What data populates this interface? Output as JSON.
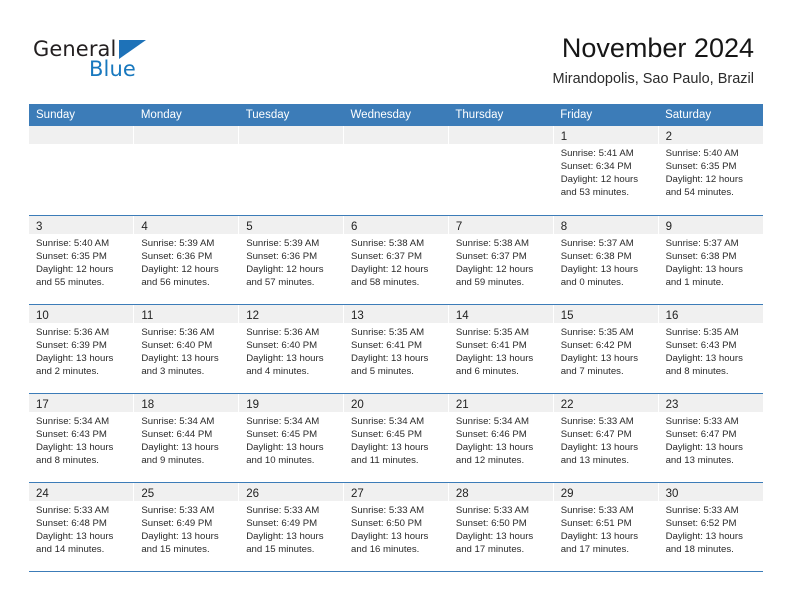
{
  "brand": {
    "name_part1": "General",
    "name_part2": "Blue",
    "accent_color": "#1e72b8"
  },
  "header": {
    "title": "November 2024",
    "subtitle": "Mirandopolis, Sao Paulo, Brazil"
  },
  "colors": {
    "header_row_bg": "#3c7cb8",
    "daynum_band_bg": "#f0f0f0",
    "row_divider": "#3c7cb8"
  },
  "weekday_headers": [
    "Sunday",
    "Monday",
    "Tuesday",
    "Wednesday",
    "Thursday",
    "Friday",
    "Saturday"
  ],
  "weeks": [
    [
      {
        "day": "",
        "sunrise": "",
        "sunset": "",
        "daylight_1": "",
        "daylight_2": ""
      },
      {
        "day": "",
        "sunrise": "",
        "sunset": "",
        "daylight_1": "",
        "daylight_2": ""
      },
      {
        "day": "",
        "sunrise": "",
        "sunset": "",
        "daylight_1": "",
        "daylight_2": ""
      },
      {
        "day": "",
        "sunrise": "",
        "sunset": "",
        "daylight_1": "",
        "daylight_2": ""
      },
      {
        "day": "",
        "sunrise": "",
        "sunset": "",
        "daylight_1": "",
        "daylight_2": ""
      },
      {
        "day": "1",
        "sunrise": "Sunrise: 5:41 AM",
        "sunset": "Sunset: 6:34 PM",
        "daylight_1": "Daylight: 12 hours",
        "daylight_2": "and 53 minutes."
      },
      {
        "day": "2",
        "sunrise": "Sunrise: 5:40 AM",
        "sunset": "Sunset: 6:35 PM",
        "daylight_1": "Daylight: 12 hours",
        "daylight_2": "and 54 minutes."
      }
    ],
    [
      {
        "day": "3",
        "sunrise": "Sunrise: 5:40 AM",
        "sunset": "Sunset: 6:35 PM",
        "daylight_1": "Daylight: 12 hours",
        "daylight_2": "and 55 minutes."
      },
      {
        "day": "4",
        "sunrise": "Sunrise: 5:39 AM",
        "sunset": "Sunset: 6:36 PM",
        "daylight_1": "Daylight: 12 hours",
        "daylight_2": "and 56 minutes."
      },
      {
        "day": "5",
        "sunrise": "Sunrise: 5:39 AM",
        "sunset": "Sunset: 6:36 PM",
        "daylight_1": "Daylight: 12 hours",
        "daylight_2": "and 57 minutes."
      },
      {
        "day": "6",
        "sunrise": "Sunrise: 5:38 AM",
        "sunset": "Sunset: 6:37 PM",
        "daylight_1": "Daylight: 12 hours",
        "daylight_2": "and 58 minutes."
      },
      {
        "day": "7",
        "sunrise": "Sunrise: 5:38 AM",
        "sunset": "Sunset: 6:37 PM",
        "daylight_1": "Daylight: 12 hours",
        "daylight_2": "and 59 minutes."
      },
      {
        "day": "8",
        "sunrise": "Sunrise: 5:37 AM",
        "sunset": "Sunset: 6:38 PM",
        "daylight_1": "Daylight: 13 hours",
        "daylight_2": "and 0 minutes."
      },
      {
        "day": "9",
        "sunrise": "Sunrise: 5:37 AM",
        "sunset": "Sunset: 6:38 PM",
        "daylight_1": "Daylight: 13 hours",
        "daylight_2": "and 1 minute."
      }
    ],
    [
      {
        "day": "10",
        "sunrise": "Sunrise: 5:36 AM",
        "sunset": "Sunset: 6:39 PM",
        "daylight_1": "Daylight: 13 hours",
        "daylight_2": "and 2 minutes."
      },
      {
        "day": "11",
        "sunrise": "Sunrise: 5:36 AM",
        "sunset": "Sunset: 6:40 PM",
        "daylight_1": "Daylight: 13 hours",
        "daylight_2": "and 3 minutes."
      },
      {
        "day": "12",
        "sunrise": "Sunrise: 5:36 AM",
        "sunset": "Sunset: 6:40 PM",
        "daylight_1": "Daylight: 13 hours",
        "daylight_2": "and 4 minutes."
      },
      {
        "day": "13",
        "sunrise": "Sunrise: 5:35 AM",
        "sunset": "Sunset: 6:41 PM",
        "daylight_1": "Daylight: 13 hours",
        "daylight_2": "and 5 minutes."
      },
      {
        "day": "14",
        "sunrise": "Sunrise: 5:35 AM",
        "sunset": "Sunset: 6:41 PM",
        "daylight_1": "Daylight: 13 hours",
        "daylight_2": "and 6 minutes."
      },
      {
        "day": "15",
        "sunrise": "Sunrise: 5:35 AM",
        "sunset": "Sunset: 6:42 PM",
        "daylight_1": "Daylight: 13 hours",
        "daylight_2": "and 7 minutes."
      },
      {
        "day": "16",
        "sunrise": "Sunrise: 5:35 AM",
        "sunset": "Sunset: 6:43 PM",
        "daylight_1": "Daylight: 13 hours",
        "daylight_2": "and 8 minutes."
      }
    ],
    [
      {
        "day": "17",
        "sunrise": "Sunrise: 5:34 AM",
        "sunset": "Sunset: 6:43 PM",
        "daylight_1": "Daylight: 13 hours",
        "daylight_2": "and 8 minutes."
      },
      {
        "day": "18",
        "sunrise": "Sunrise: 5:34 AM",
        "sunset": "Sunset: 6:44 PM",
        "daylight_1": "Daylight: 13 hours",
        "daylight_2": "and 9 minutes."
      },
      {
        "day": "19",
        "sunrise": "Sunrise: 5:34 AM",
        "sunset": "Sunset: 6:45 PM",
        "daylight_1": "Daylight: 13 hours",
        "daylight_2": "and 10 minutes."
      },
      {
        "day": "20",
        "sunrise": "Sunrise: 5:34 AM",
        "sunset": "Sunset: 6:45 PM",
        "daylight_1": "Daylight: 13 hours",
        "daylight_2": "and 11 minutes."
      },
      {
        "day": "21",
        "sunrise": "Sunrise: 5:34 AM",
        "sunset": "Sunset: 6:46 PM",
        "daylight_1": "Daylight: 13 hours",
        "daylight_2": "and 12 minutes."
      },
      {
        "day": "22",
        "sunrise": "Sunrise: 5:33 AM",
        "sunset": "Sunset: 6:47 PM",
        "daylight_1": "Daylight: 13 hours",
        "daylight_2": "and 13 minutes."
      },
      {
        "day": "23",
        "sunrise": "Sunrise: 5:33 AM",
        "sunset": "Sunset: 6:47 PM",
        "daylight_1": "Daylight: 13 hours",
        "daylight_2": "and 13 minutes."
      }
    ],
    [
      {
        "day": "24",
        "sunrise": "Sunrise: 5:33 AM",
        "sunset": "Sunset: 6:48 PM",
        "daylight_1": "Daylight: 13 hours",
        "daylight_2": "and 14 minutes."
      },
      {
        "day": "25",
        "sunrise": "Sunrise: 5:33 AM",
        "sunset": "Sunset: 6:49 PM",
        "daylight_1": "Daylight: 13 hours",
        "daylight_2": "and 15 minutes."
      },
      {
        "day": "26",
        "sunrise": "Sunrise: 5:33 AM",
        "sunset": "Sunset: 6:49 PM",
        "daylight_1": "Daylight: 13 hours",
        "daylight_2": "and 15 minutes."
      },
      {
        "day": "27",
        "sunrise": "Sunrise: 5:33 AM",
        "sunset": "Sunset: 6:50 PM",
        "daylight_1": "Daylight: 13 hours",
        "daylight_2": "and 16 minutes."
      },
      {
        "day": "28",
        "sunrise": "Sunrise: 5:33 AM",
        "sunset": "Sunset: 6:50 PM",
        "daylight_1": "Daylight: 13 hours",
        "daylight_2": "and 17 minutes."
      },
      {
        "day": "29",
        "sunrise": "Sunrise: 5:33 AM",
        "sunset": "Sunset: 6:51 PM",
        "daylight_1": "Daylight: 13 hours",
        "daylight_2": "and 17 minutes."
      },
      {
        "day": "30",
        "sunrise": "Sunrise: 5:33 AM",
        "sunset": "Sunset: 6:52 PM",
        "daylight_1": "Daylight: 13 hours",
        "daylight_2": "and 18 minutes."
      }
    ]
  ]
}
